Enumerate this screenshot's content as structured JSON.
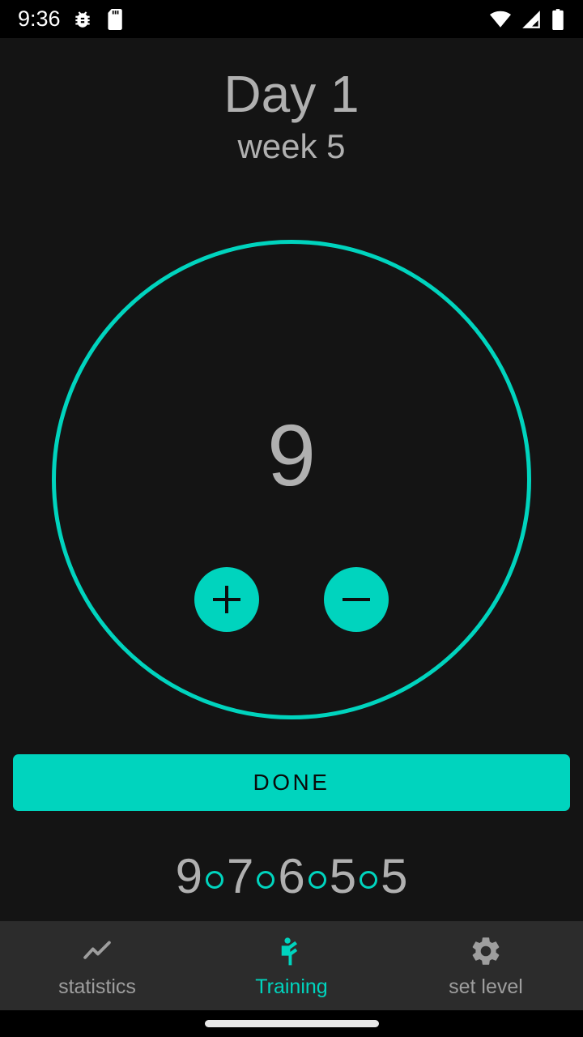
{
  "status_bar": {
    "clock": "9:36",
    "icons": [
      "bug-icon",
      "sd-card-icon"
    ],
    "right_icons": [
      "wifi-icon",
      "cellular-signal-icon",
      "battery-icon"
    ]
  },
  "header": {
    "title": "Day 1",
    "subtitle": "week 5"
  },
  "counter": {
    "value": "9",
    "increment_label": "+",
    "decrement_label": "−",
    "ring_color": "#00d4be"
  },
  "done_button": {
    "label": "DONE",
    "background": "#00d4be",
    "text_color": "#0a0a0a"
  },
  "history": {
    "values": [
      "9",
      "7",
      "6",
      "5",
      "5"
    ],
    "separator": "circle-outline",
    "separator_color": "#00d4be",
    "number_color": "#b0b0b0"
  },
  "bottom_nav": {
    "items": [
      {
        "label": "statistics",
        "icon": "trend-line-icon",
        "active": false
      },
      {
        "label": "Training",
        "icon": "martial-arts-kick-icon",
        "active": true
      },
      {
        "label": "set level",
        "icon": "gear-icon",
        "active": false
      }
    ],
    "active_color": "#00d4be",
    "inactive_color": "#9e9e9e"
  },
  "theme": {
    "accent": "#00d4be",
    "background": "#141414",
    "nav_background": "#2c2c2c",
    "text_muted": "#b0b0b0"
  }
}
